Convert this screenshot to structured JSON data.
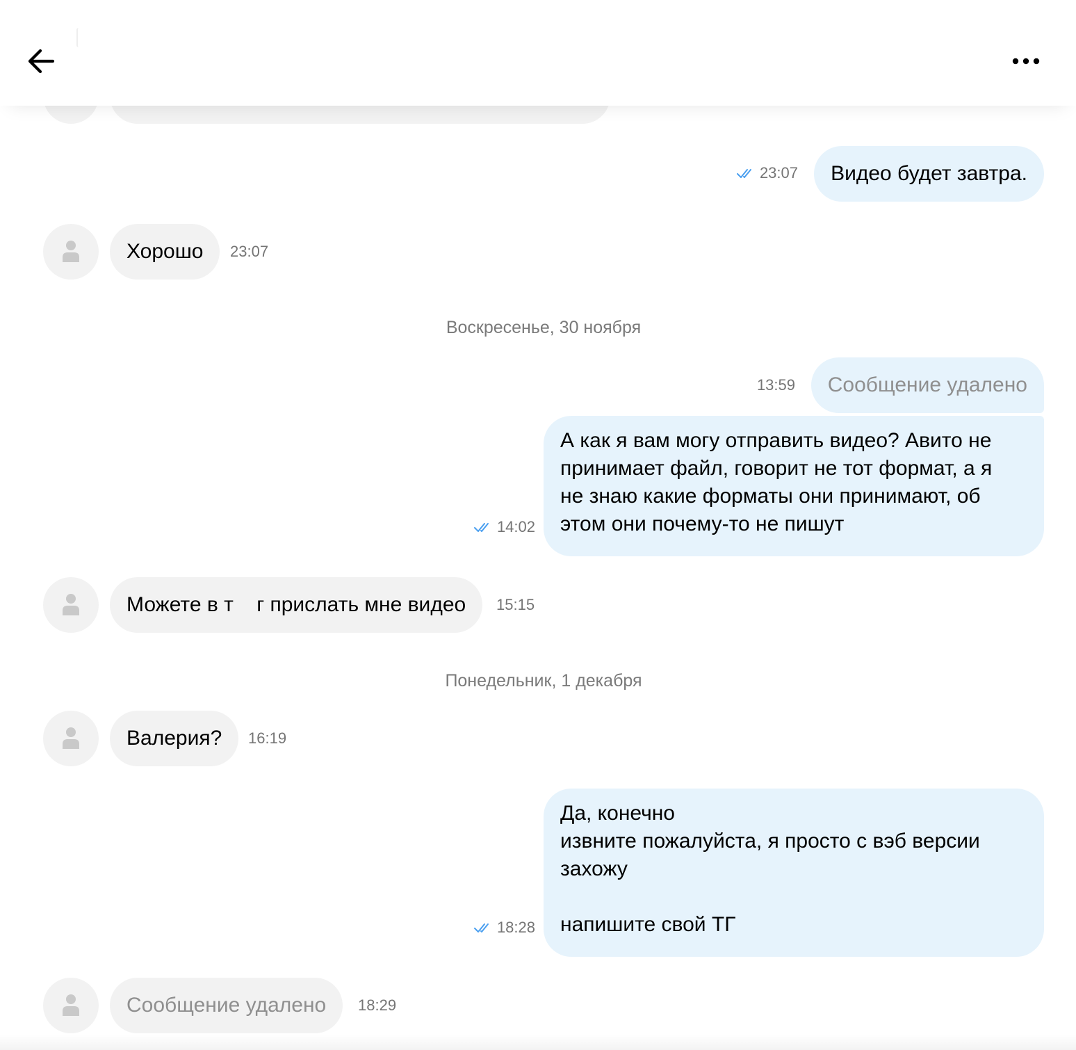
{
  "header": {
    "back_icon": "arrow-left-icon",
    "more_icon": "more-horizontal-icon"
  },
  "colors": {
    "incoming_bubble": "#f2f2f2",
    "outgoing_bubble": "#e6f3fc",
    "read_checks": "#4a9ff0",
    "timestamp": "#757575",
    "deleted_text": "#8f8f8f"
  },
  "messages": {
    "m1": {
      "text": "Видео будет завтра.",
      "time": "23:07",
      "status": "read"
    },
    "m2": {
      "text": "Хорошо",
      "time": "23:07"
    },
    "m3": {
      "text": "Сообщение удалено",
      "time": "13:59"
    },
    "m4": {
      "text": "А как я вам могу отправить видео? Авито не\nпринимает файл, говорит не тот формат, а я\nне знаю какие форматы они принимают, об\nэтом они почему-то не пишут",
      "time": "14:02",
      "status": "read"
    },
    "m5": {
      "text": "Можете в т    г прислать мне видео",
      "time": "15:15"
    },
    "m6": {
      "text": "Валерия?",
      "time": "16:19"
    },
    "m7": {
      "text": "Да, конечно\nизвните пожалуйста, я просто с вэб версии\nзахожу\n\nнапишите свой ТГ",
      "time": "18:28",
      "status": "read"
    },
    "m8": {
      "text": "Сообщение удалено",
      "time": "18:29"
    }
  },
  "dates": {
    "d1": "Воскресенье, 30 ноября",
    "d2": "Понедельник, 1 декабря"
  }
}
